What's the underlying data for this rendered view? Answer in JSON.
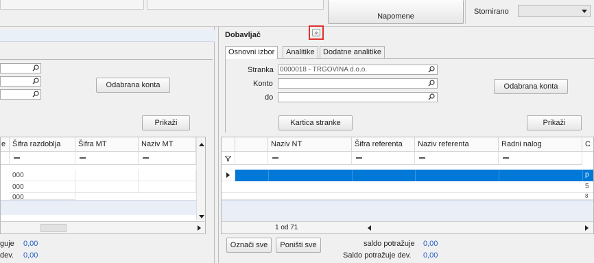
{
  "top": {
    "napomene_label": "Napomene",
    "stornirano_label": "Stornirano",
    "stornirano_value": ""
  },
  "left_panel": {
    "odabrana_konta_label": "Odabrana konta",
    "prikazi_label": "Prikaži",
    "columns": [
      "e",
      "Šifra razdoblja",
      "Šifra MT",
      "Naziv MT"
    ],
    "rows": [
      [
        "",
        "000",
        "",
        ""
      ],
      [
        "",
        "000",
        "",
        ""
      ],
      [
        "",
        "000",
        "",
        ""
      ]
    ],
    "footer_line1_label": "guje",
    "footer_line1_value": "0,00",
    "footer_line2_label": "dev.",
    "footer_line2_value": "0,00"
  },
  "right_panel": {
    "title": "Dobavljač",
    "collapse_glyph": "«",
    "tabs": [
      "Osnovni izbor",
      "Analitike",
      "Dodatne analitike"
    ],
    "stranka_label": "Stranka",
    "stranka_value": "0000018 - TRGOVINA d.o.o.",
    "konto_label": "Konto",
    "konto_value": "",
    "do_label": "do",
    "do_value": "",
    "odabrana_konta_label": "Odabrana konta",
    "kartica_stranke_label": "Kartica stranke",
    "prikazi_label": "Prikaži",
    "columns": [
      "Naziv NT",
      "Šifra referenta",
      "Naziv referenta",
      "Radni nalog",
      "C"
    ],
    "pager": "1 od 71",
    "right_edge_chars": [
      "p",
      "5",
      "8"
    ],
    "oznaci_sve_label": "Označi sve",
    "ponisti_sve_label": "Poništi sve",
    "saldo_potrazuje_label": "saldo potražuje",
    "saldo_potrazuje_value": "0,00",
    "saldo_potrazuje_dev_label": "Saldo potražuje dev.",
    "saldo_potrazuje_dev_value": "0,00"
  },
  "colors": {
    "selection": "#0078d7",
    "highlight_box": "#e03030",
    "value_blue": "#1f5fc6"
  }
}
